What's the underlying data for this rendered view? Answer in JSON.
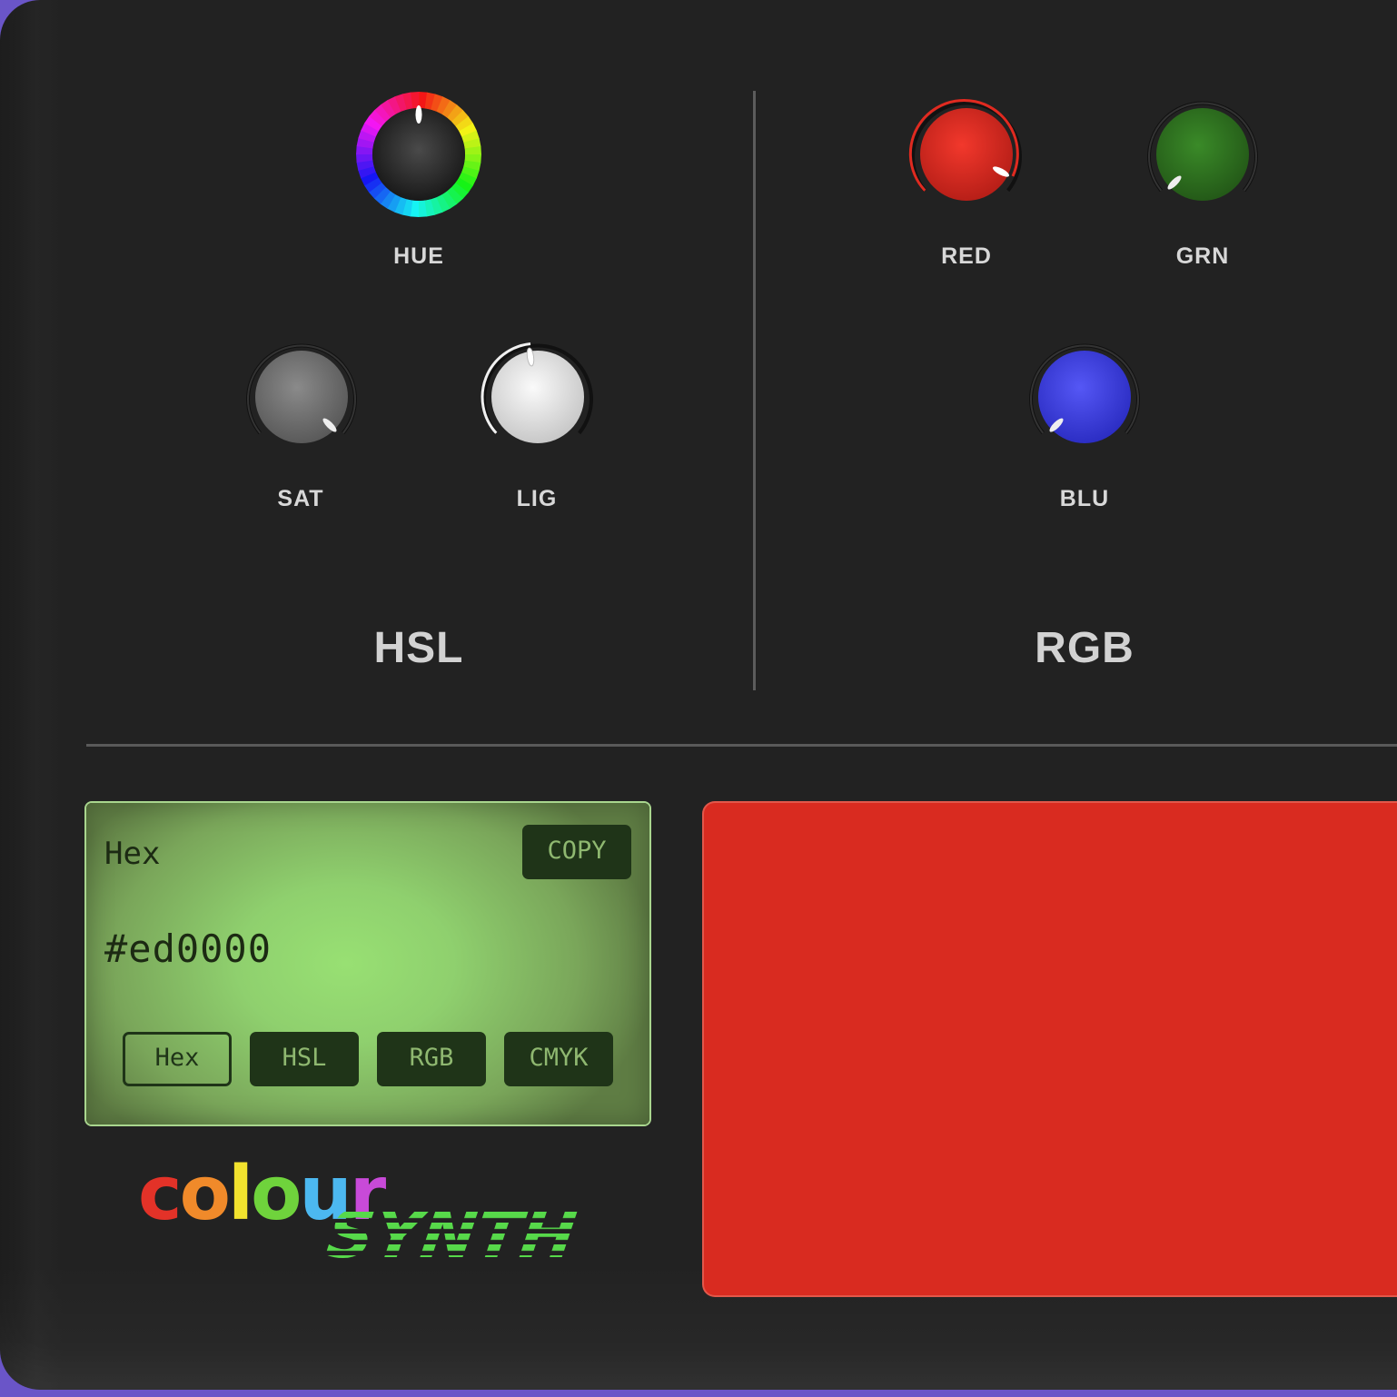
{
  "hsl": {
    "title": "HSL",
    "knobs": [
      {
        "id": "hue",
        "label": "HUE",
        "level": 0.5
      },
      {
        "id": "sat",
        "label": "SAT",
        "level": 0.93
      },
      {
        "id": "lig",
        "label": "LIG",
        "level": 0.47
      }
    ]
  },
  "rgb": {
    "title": "RGB",
    "knobs": [
      {
        "id": "red",
        "label": "RED",
        "level": 0.93,
        "color": "#e32d23"
      },
      {
        "id": "grn",
        "label": "GRN",
        "level": 0.0,
        "color": "#2e7d1f"
      },
      {
        "id": "blu",
        "label": "BLU",
        "level": 0.0,
        "color": "#3d3fe0"
      }
    ]
  },
  "display": {
    "title": "Hex",
    "value": "#ed0000",
    "copy_label": "COPY",
    "formats": [
      "Hex",
      "HSL",
      "RGB",
      "CMYK"
    ],
    "active_format": "Hex"
  },
  "swatch": {
    "color": "#d92b20"
  },
  "logo": {
    "word1": "colour",
    "word2": "SYNTH"
  },
  "colors": {
    "accent_green": "#57d94a",
    "panel": "#222222",
    "lcd": "#94d772"
  }
}
